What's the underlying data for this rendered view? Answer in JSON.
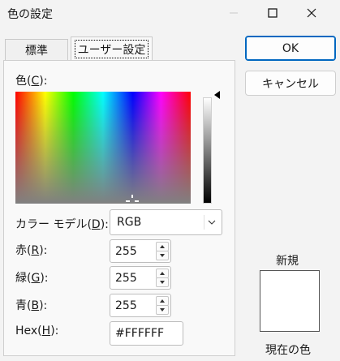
{
  "window": {
    "title": "色の設定",
    "min_symbol": "—",
    "max_symbol": "☐",
    "close_symbol": "✕"
  },
  "tabs": [
    {
      "label": "標準",
      "selected": false
    },
    {
      "label": "ユーザー設定",
      "selected": true
    }
  ],
  "color_label": {
    "text": "色(",
    "key": "C",
    "suffix": "):"
  },
  "color_model": {
    "label_pre": "カラー モデル(",
    "key": "D",
    "label_post": "):",
    "value": "RGB"
  },
  "red": {
    "label_pre": "赤(",
    "key": "R",
    "label_post": "):",
    "value": "255"
  },
  "green": {
    "label_pre": "緑(",
    "key": "G",
    "label_post": "):",
    "value": "255"
  },
  "blue": {
    "label_pre": "青(",
    "key": "B",
    "label_post": "):",
    "value": "255"
  },
  "hex": {
    "label_pre": "Hex(",
    "key": "H",
    "label_post": "):",
    "value": "#FFFFFF"
  },
  "buttons": {
    "ok": "OK",
    "cancel": "キャンセル"
  },
  "preview": {
    "new_label": "新規",
    "current_label": "現在の色",
    "color": "#FFFFFF"
  }
}
